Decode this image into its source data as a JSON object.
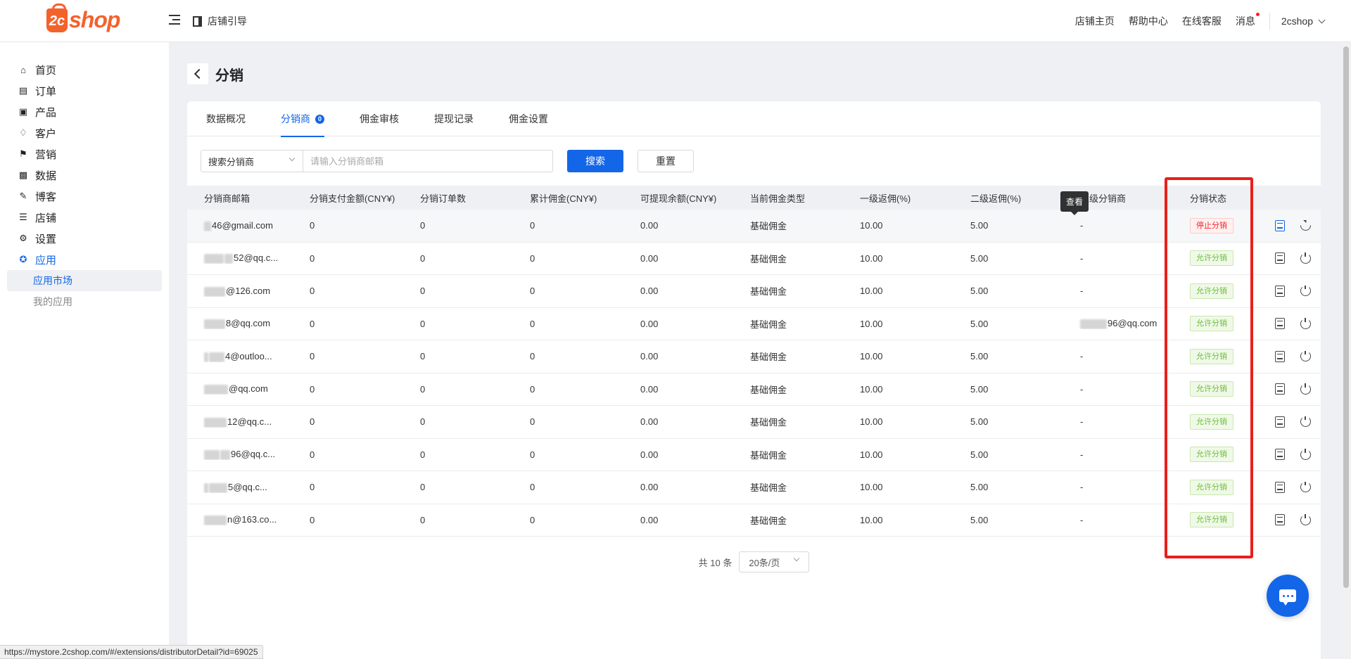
{
  "brand": {
    "logo_mark": "2c",
    "logo_text": "shop",
    "color": "#f4622b"
  },
  "header": {
    "guide_label": "店铺引导",
    "links": [
      "店铺主页",
      "帮助中心",
      "在线客服",
      "消息"
    ],
    "user": "2cshop"
  },
  "sidebar": {
    "items": [
      {
        "label": "首页",
        "icon": "home-icon"
      },
      {
        "label": "订单",
        "icon": "order-icon"
      },
      {
        "label": "产品",
        "icon": "product-icon"
      },
      {
        "label": "客户",
        "icon": "customer-icon"
      },
      {
        "label": "营销",
        "icon": "tag-icon"
      },
      {
        "label": "数据",
        "icon": "chart-icon"
      },
      {
        "label": "博客",
        "icon": "blog-icon"
      },
      {
        "label": "店铺",
        "icon": "store-icon"
      },
      {
        "label": "设置",
        "icon": "gear-icon"
      },
      {
        "label": "应用",
        "icon": "puzzle-icon"
      }
    ],
    "sub_items": [
      "应用市场",
      "我的应用"
    ]
  },
  "page": {
    "title": "分销"
  },
  "tabs": [
    {
      "label": "数据概况"
    },
    {
      "label": "分销商",
      "badge": "0"
    },
    {
      "label": "佣金审核"
    },
    {
      "label": "提现记录"
    },
    {
      "label": "佣金设置"
    }
  ],
  "search": {
    "select_value": "搜索分销商",
    "placeholder": "请输入分销商邮箱",
    "search_label": "搜索",
    "reset_label": "重置"
  },
  "table": {
    "columns": [
      "分销商邮箱",
      "分销支付金额(CNY¥)",
      "分销订单数",
      "累计佣金(CNY¥)",
      "可提现余额(CNY¥)",
      "当前佣金类型",
      "一级返佣(%)",
      "二级返佣(%)",
      "上级分销商",
      "分销状态"
    ],
    "rows": [
      {
        "email": "46@gmail.com",
        "pay": "0",
        "orders": "0",
        "commission": "0",
        "balance": "0.00",
        "type": "基础佣金",
        "l1": "10.00",
        "l2": "5.00",
        "parent": "-",
        "status": "停止分销"
      },
      {
        "email": "52@qq.c...",
        "pay": "0",
        "orders": "0",
        "commission": "0",
        "balance": "0.00",
        "type": "基础佣金",
        "l1": "10.00",
        "l2": "5.00",
        "parent": "-",
        "status": "允许分销"
      },
      {
        "email": "@126.com",
        "pay": "0",
        "orders": "0",
        "commission": "0",
        "balance": "0.00",
        "type": "基础佣金",
        "l1": "10.00",
        "l2": "5.00",
        "parent": "-",
        "status": "允许分销"
      },
      {
        "email": "8@qq.com",
        "pay": "0",
        "orders": "0",
        "commission": "0",
        "balance": "0.00",
        "type": "基础佣金",
        "l1": "10.00",
        "l2": "5.00",
        "parent": "96@qq.com",
        "status": "允许分销"
      },
      {
        "email": "4@outloo...",
        "pay": "0",
        "orders": "0",
        "commission": "0",
        "balance": "0.00",
        "type": "基础佣金",
        "l1": "10.00",
        "l2": "5.00",
        "parent": "-",
        "status": "允许分销"
      },
      {
        "email": "@qq.com",
        "pay": "0",
        "orders": "0",
        "commission": "0",
        "balance": "0.00",
        "type": "基础佣金",
        "l1": "10.00",
        "l2": "5.00",
        "parent": "-",
        "status": "允许分销"
      },
      {
        "email": "12@qq.c...",
        "pay": "0",
        "orders": "0",
        "commission": "0",
        "balance": "0.00",
        "type": "基础佣金",
        "l1": "10.00",
        "l2": "5.00",
        "parent": "-",
        "status": "允许分销"
      },
      {
        "email": "96@qq.c...",
        "pay": "0",
        "orders": "0",
        "commission": "0",
        "balance": "0.00",
        "type": "基础佣金",
        "l1": "10.00",
        "l2": "5.00",
        "parent": "-",
        "status": "允许分销"
      },
      {
        "email": "5@qq.c...",
        "pay": "0",
        "orders": "0",
        "commission": "0",
        "balance": "0.00",
        "type": "基础佣金",
        "l1": "10.00",
        "l2": "5.00",
        "parent": "-",
        "status": "允许分销"
      },
      {
        "email": "n@163.co...",
        "pay": "0",
        "orders": "0",
        "commission": "0",
        "balance": "0.00",
        "type": "基础佣金",
        "l1": "10.00",
        "l2": "5.00",
        "parent": "-",
        "status": "允许分销"
      }
    ]
  },
  "tooltip": "查看",
  "pager": {
    "total": "共 10 条",
    "page_size": "20条/页"
  },
  "status_url": "https://mystore.2cshop.com/#/extensions/distributorDetail?id=69025"
}
